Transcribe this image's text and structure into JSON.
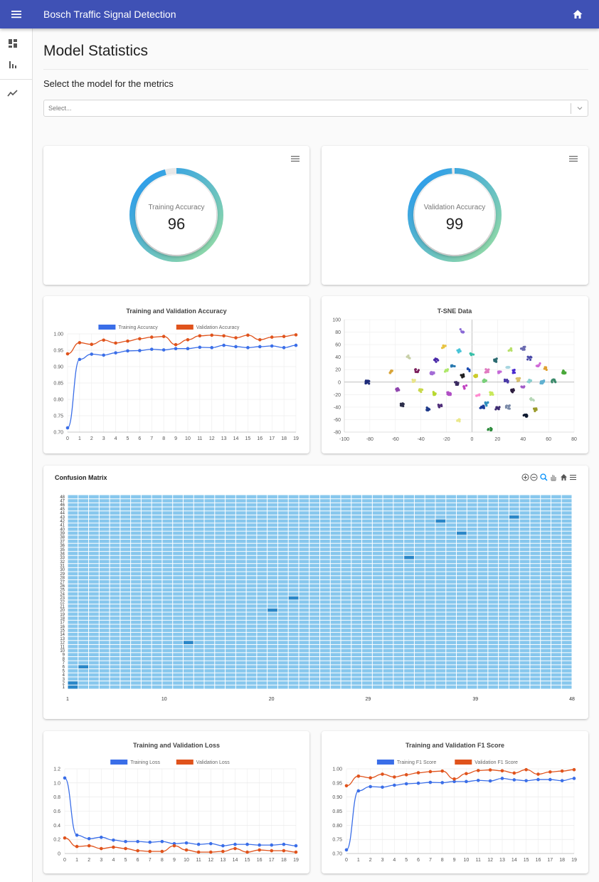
{
  "app": {
    "title": "Bosch Traffic Signal Detection"
  },
  "page": {
    "title": "Model Statistics",
    "select_label": "Select the model for the metrics",
    "select_placeholder": "Select..."
  },
  "gauges": [
    {
      "label": "Training Accuracy",
      "value": "96",
      "percent": 96
    },
    {
      "label": "Validation Accuracy",
      "value": "99",
      "percent": 99
    }
  ],
  "colors": {
    "appbar": "#3f51b5",
    "training": "#3a6ee8",
    "validation": "#e0531c",
    "heatmap_base": "#87c7ed",
    "heatmap_high": "#2a87c8",
    "gauge_start": "#9be0a0",
    "gauge_end": "#2196f3"
  },
  "icons": {
    "menu": "menu-icon",
    "home": "home-icon",
    "dashboard": "dashboard-icon",
    "bar_chart": "bar-chart-icon",
    "trend": "trending-icon",
    "chevron": "chevron-down-icon"
  },
  "confusion_matrix": {
    "title": "Confusion Matrix",
    "x_ticks": [
      "1",
      "10",
      "20",
      "29",
      "39",
      "48"
    ],
    "y_labels": [
      "1",
      "2",
      "3",
      "4",
      "5",
      "6",
      "7",
      "8",
      "9",
      "10",
      "11",
      "12",
      "13",
      "14",
      "15",
      "16",
      "17",
      "18",
      "19",
      "20",
      "21",
      "22",
      "23",
      "24",
      "25",
      "26",
      "27",
      "28",
      "29",
      "30",
      "31",
      "32",
      "33",
      "34",
      "35",
      "36",
      "37",
      "38",
      "39",
      "40",
      "41",
      "42",
      "43",
      "44",
      "45",
      "46",
      "47",
      "48"
    ],
    "size": 48,
    "highlights": [
      [
        1,
        1
      ],
      [
        1,
        2
      ],
      [
        2,
        6
      ],
      [
        12,
        12
      ],
      [
        20,
        20
      ],
      [
        22,
        23
      ],
      [
        33,
        33
      ],
      [
        36,
        42
      ],
      [
        38,
        39
      ],
      [
        43,
        43
      ]
    ]
  },
  "chart_data": [
    {
      "type": "line",
      "title": "Training and Validation Accuracy",
      "x": [
        0,
        1,
        2,
        3,
        4,
        5,
        6,
        7,
        8,
        9,
        10,
        11,
        12,
        13,
        14,
        15,
        16,
        17,
        18,
        19
      ],
      "series": [
        {
          "name": "Training Accuracy",
          "values": [
            0.713,
            0.922,
            0.938,
            0.935,
            0.942,
            0.948,
            0.949,
            0.953,
            0.951,
            0.955,
            0.955,
            0.959,
            0.958,
            0.965,
            0.961,
            0.958,
            0.961,
            0.963,
            0.958,
            0.965
          ]
        },
        {
          "name": "Validation Accuracy",
          "values": [
            0.939,
            0.973,
            0.968,
            0.981,
            0.972,
            0.978,
            0.985,
            0.99,
            0.992,
            0.967,
            0.982,
            0.994,
            0.996,
            0.994,
            0.988,
            0.996,
            0.982,
            0.99,
            0.992,
            0.997
          ]
        }
      ],
      "ylim": [
        0.7,
        1.0
      ],
      "yticks": [
        "0.70",
        "0.75",
        "0.80",
        "0.85",
        "0.90",
        "0.95",
        "1.00"
      ],
      "legend": "top"
    },
    {
      "type": "scatter",
      "title": "T-SNE Data",
      "xlim": [
        -100,
        80
      ],
      "ylim": [
        -80,
        100
      ],
      "xticks": [
        "-100",
        "-80",
        "-60",
        "-40",
        "-20",
        "0",
        "20",
        "40",
        "60",
        "80"
      ],
      "yticks": [
        "100",
        "80",
        "60",
        "40",
        "20",
        "0",
        "-20",
        "-40",
        "-60",
        "-80"
      ],
      "clusters": [
        {
          "x": -82,
          "y": 0,
          "color": "#1e2c7a",
          "n": 14
        },
        {
          "x": -63,
          "y": 17,
          "color": "#d9a53a",
          "n": 8
        },
        {
          "x": -58,
          "y": -12,
          "color": "#8e44ad",
          "n": 8
        },
        {
          "x": -55,
          "y": -36,
          "color": "#2c2e4a",
          "n": 8
        },
        {
          "x": -50,
          "y": 40,
          "color": "#c8d0a8",
          "n": 6
        },
        {
          "x": -45,
          "y": 3,
          "color": "#e8e48a",
          "n": 6
        },
        {
          "x": -43,
          "y": 18,
          "color": "#7b1f5c",
          "n": 8
        },
        {
          "x": -40,
          "y": -14,
          "color": "#c8d84a",
          "n": 10
        },
        {
          "x": -34,
          "y": -43,
          "color": "#1f3a8a",
          "n": 8
        },
        {
          "x": -31,
          "y": 15,
          "color": "#a36cd6",
          "n": 10
        },
        {
          "x": -30,
          "y": -18,
          "color": "#b8d830",
          "n": 10
        },
        {
          "x": -28,
          "y": 35,
          "color": "#4a2aa8",
          "n": 8
        },
        {
          "x": -25,
          "y": -38,
          "color": "#502f7a",
          "n": 8
        },
        {
          "x": -22,
          "y": 56,
          "color": "#e8c340",
          "n": 8
        },
        {
          "x": -20,
          "y": 18,
          "color": "#aee86a",
          "n": 6
        },
        {
          "x": -18,
          "y": -18,
          "color": "#b04fc5",
          "n": 10
        },
        {
          "x": -15,
          "y": 26,
          "color": "#2a7ab0",
          "n": 6
        },
        {
          "x": -12,
          "y": -2,
          "color": "#3a2a60",
          "n": 10
        },
        {
          "x": -10,
          "y": 50,
          "color": "#48c4d8",
          "n": 8
        },
        {
          "x": -10,
          "y": -62,
          "color": "#eae88a",
          "n": 6
        },
        {
          "x": -8,
          "y": 82,
          "color": "#8a6ad6",
          "n": 6
        },
        {
          "x": -7,
          "y": 10,
          "color": "#1e1e1e",
          "n": 8
        },
        {
          "x": -2,
          "y": 20,
          "color": "#1e4db0",
          "n": 6
        },
        {
          "x": 0,
          "y": 45,
          "color": "#39c0a8",
          "n": 6
        },
        {
          "x": 3,
          "y": 10,
          "color": "#cbcb2a",
          "n": 8
        },
        {
          "x": 5,
          "y": -22,
          "color": "#ff8ad0",
          "n": 6
        },
        {
          "x": 8,
          "y": -40,
          "color": "#1a3a9a",
          "n": 8
        },
        {
          "x": 10,
          "y": 2,
          "color": "#7ad07a",
          "n": 8
        },
        {
          "x": 12,
          "y": 18,
          "color": "#e07ac0",
          "n": 8
        },
        {
          "x": 12,
          "y": -35,
          "color": "#3090c0",
          "n": 8
        },
        {
          "x": 14,
          "y": -76,
          "color": "#2a8a3a",
          "n": 6
        },
        {
          "x": 15,
          "y": -18,
          "color": "#c8e85a",
          "n": 8
        },
        {
          "x": 18,
          "y": 35,
          "color": "#2a6a70",
          "n": 8
        },
        {
          "x": 20,
          "y": -42,
          "color": "#3c2a70",
          "n": 8
        },
        {
          "x": 22,
          "y": 15,
          "color": "#c56ad8",
          "n": 6
        },
        {
          "x": 27,
          "y": 2,
          "color": "#4a3aa8",
          "n": 8
        },
        {
          "x": 28,
          "y": 25,
          "color": "#a8d6e0",
          "n": 8
        },
        {
          "x": 28,
          "y": -40,
          "color": "#7a8aa8",
          "n": 8
        },
        {
          "x": 30,
          "y": 52,
          "color": "#b8e06a",
          "n": 6
        },
        {
          "x": 32,
          "y": -14,
          "color": "#2e1e40",
          "n": 8
        },
        {
          "x": 33,
          "y": 17,
          "color": "#4a2ad0",
          "n": 6
        },
        {
          "x": 36,
          "y": 4,
          "color": "#d8c06a",
          "n": 8
        },
        {
          "x": 40,
          "y": -6,
          "color": "#a05ac8",
          "n": 6
        },
        {
          "x": 42,
          "y": -54,
          "color": "#0e1a30",
          "n": 12
        },
        {
          "x": 45,
          "y": 2,
          "color": "#8ad0d0",
          "n": 8
        },
        {
          "x": 45,
          "y": 38,
          "color": "#4a4aa8",
          "n": 6
        },
        {
          "x": 47,
          "y": -28,
          "color": "#b8d8b8",
          "n": 6
        },
        {
          "x": 50,
          "y": -44,
          "color": "#9a9a2a",
          "n": 8
        },
        {
          "x": 52,
          "y": 28,
          "color": "#d06ad8",
          "n": 6
        },
        {
          "x": 55,
          "y": 0,
          "color": "#60b0d0",
          "n": 8
        },
        {
          "x": 58,
          "y": 22,
          "color": "#e0a030",
          "n": 6
        },
        {
          "x": 64,
          "y": 2,
          "color": "#3a8a6a",
          "n": 8
        },
        {
          "x": 72,
          "y": 16,
          "color": "#4aa83a",
          "n": 10
        },
        {
          "x": 40,
          "y": 54,
          "color": "#6a6ab0",
          "n": 8
        },
        {
          "x": -5,
          "y": -8,
          "color": "#c040c0",
          "n": 6
        }
      ]
    },
    {
      "type": "line",
      "title": "Training and Validation Loss",
      "x": [
        0,
        1,
        2,
        3,
        4,
        5,
        6,
        7,
        8,
        9,
        10,
        11,
        12,
        13,
        14,
        15,
        16,
        17,
        18,
        19
      ],
      "series": [
        {
          "name": "Training Loss",
          "values": [
            1.07,
            0.26,
            0.21,
            0.23,
            0.19,
            0.17,
            0.17,
            0.16,
            0.17,
            0.14,
            0.15,
            0.13,
            0.14,
            0.11,
            0.13,
            0.13,
            0.12,
            0.12,
            0.13,
            0.11
          ]
        },
        {
          "name": "Validation Loss",
          "values": [
            0.22,
            0.1,
            0.11,
            0.07,
            0.09,
            0.07,
            0.04,
            0.03,
            0.03,
            0.11,
            0.05,
            0.02,
            0.02,
            0.03,
            0.07,
            0.02,
            0.05,
            0.04,
            0.04,
            0.02
          ]
        }
      ],
      "ylim": [
        0,
        1.2
      ],
      "yticks": [
        "0",
        "0.2",
        "0.4",
        "0.6",
        "0.8",
        "1.0",
        "1.2"
      ],
      "legend": "top"
    },
    {
      "type": "line",
      "title": "Training and Validation F1 Score",
      "x": [
        0,
        1,
        2,
        3,
        4,
        5,
        6,
        7,
        8,
        9,
        10,
        11,
        12,
        13,
        14,
        15,
        16,
        17,
        18,
        19
      ],
      "series": [
        {
          "name": "Training F1 Score",
          "values": [
            0.713,
            0.922,
            0.937,
            0.935,
            0.942,
            0.947,
            0.949,
            0.952,
            0.951,
            0.955,
            0.955,
            0.959,
            0.957,
            0.966,
            0.961,
            0.958,
            0.962,
            0.962,
            0.958,
            0.966
          ]
        },
        {
          "name": "Validation F1 Score",
          "values": [
            0.94,
            0.974,
            0.968,
            0.981,
            0.971,
            0.979,
            0.986,
            0.99,
            0.992,
            0.964,
            0.983,
            0.994,
            0.996,
            0.993,
            0.985,
            0.997,
            0.981,
            0.989,
            0.992,
            0.997
          ]
        }
      ],
      "ylim": [
        0.7,
        1.0
      ],
      "yticks": [
        "0.70",
        "0.75",
        "0.80",
        "0.85",
        "0.90",
        "0.95",
        "1.00"
      ],
      "legend": "top"
    }
  ]
}
